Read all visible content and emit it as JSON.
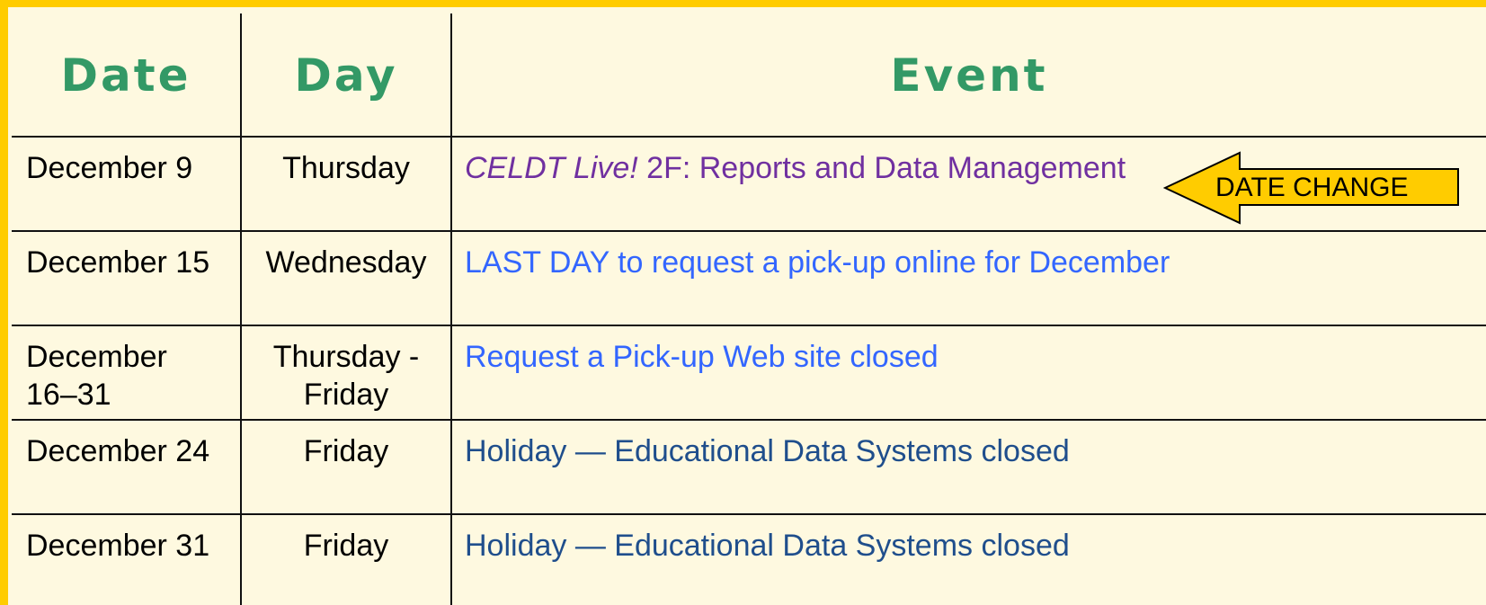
{
  "headers": {
    "date": "Date",
    "day": "Day",
    "event": "Event"
  },
  "rows": [
    {
      "date": "December 9",
      "day": "Thursday",
      "event_italic": "CELDT Live!",
      "event_rest": " 2F: Reports and Data Management"
    },
    {
      "date": "December 15",
      "day": "Wednesday",
      "event": "LAST DAY to request a pick-up online for December"
    },
    {
      "date_line1": "December",
      "date_line2": "16–31",
      "day_line1": "Thursday -",
      "day_line2": "Friday",
      "event": "Request a Pick-up Web site closed"
    },
    {
      "date": "December 24",
      "day": "Friday",
      "event": "Holiday — Educational Data Systems closed"
    },
    {
      "date": "December 31",
      "day": "Friday",
      "event": "Holiday — Educational Data Systems closed"
    }
  ],
  "callout": {
    "label": "DATE CHANGE"
  },
  "colors": {
    "background": "#fef9e0",
    "border_accent": "#ffcc00",
    "header_text": "#339966",
    "event_purple": "#7030a0",
    "event_blue": "#3366ff",
    "event_navy": "#1f4e8c",
    "arrow_fill": "#ffcc00"
  }
}
